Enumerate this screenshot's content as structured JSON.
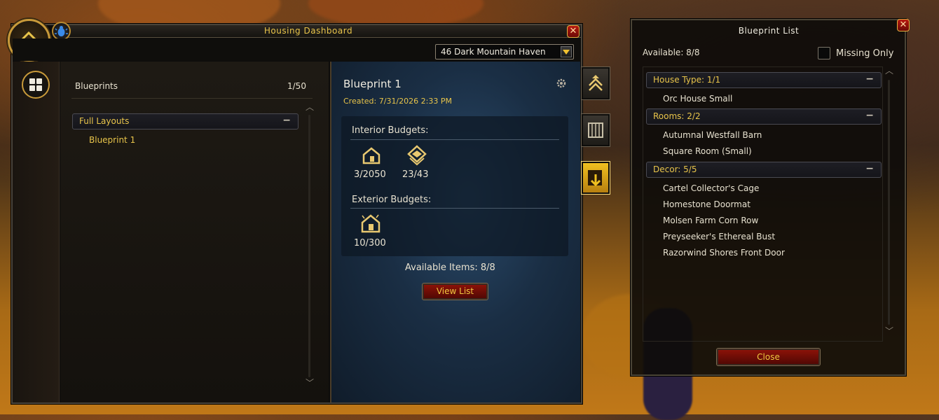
{
  "dashboard": {
    "title": "Housing Dashboard",
    "house_select": "46 Dark Mountain Haven",
    "blueprints_label": "Blueprints",
    "blueprints_count": "1/50",
    "group_label": "Full Layouts",
    "group_items": [
      "Blueprint 1"
    ]
  },
  "detail": {
    "name": "Blueprint 1",
    "created": "Created: 7/31/2026 2:33 PM",
    "interior_label": "Interior Budgets:",
    "interior_values": [
      "3/2050",
      "23/43"
    ],
    "exterior_label": "Exterior Budgets:",
    "exterior_values": [
      "10/300"
    ],
    "available_items": "Available Items: 8/8",
    "view_list_label": "View List"
  },
  "list_panel": {
    "title": "Blueprint List",
    "available": "Available: 8/8",
    "missing_only_label": "Missing Only",
    "missing_only_checked": false,
    "groups": [
      {
        "label": "House Type: 1/1",
        "items": [
          "Orc House Small"
        ]
      },
      {
        "label": "Rooms: 2/2",
        "items": [
          "Autumnal Westfall Barn",
          "Square Room (Small)"
        ]
      },
      {
        "label": "Decor: 5/5",
        "items": [
          "Cartel Collector's Cage",
          "Homestone Doormat",
          "Molsen Farm Corn Row",
          "Preyseeker's Ethereal Bust",
          "Razorwind Shores Front Door"
        ]
      }
    ],
    "close_label": "Close"
  },
  "icons": {
    "house_logo": "housing-logo-icon",
    "bug": "bug-icon",
    "dropdown": "dropdown-arrow-icon",
    "grid": "grid-layout-icon",
    "gear": "gear-icon",
    "interior_house": "interior-house-icon",
    "interior_layers": "interior-rooms-icon",
    "exterior_house": "exterior-house-icon",
    "tab_upgrade": "house-upgrade-tab-icon",
    "tab_catalog": "catalog-tab-icon",
    "tab_blueprints": "blueprint-tab-icon"
  },
  "colors": {
    "gold": "#e8c44a",
    "panel_blue": "#1c3048",
    "button_red": "#8a1208"
  }
}
